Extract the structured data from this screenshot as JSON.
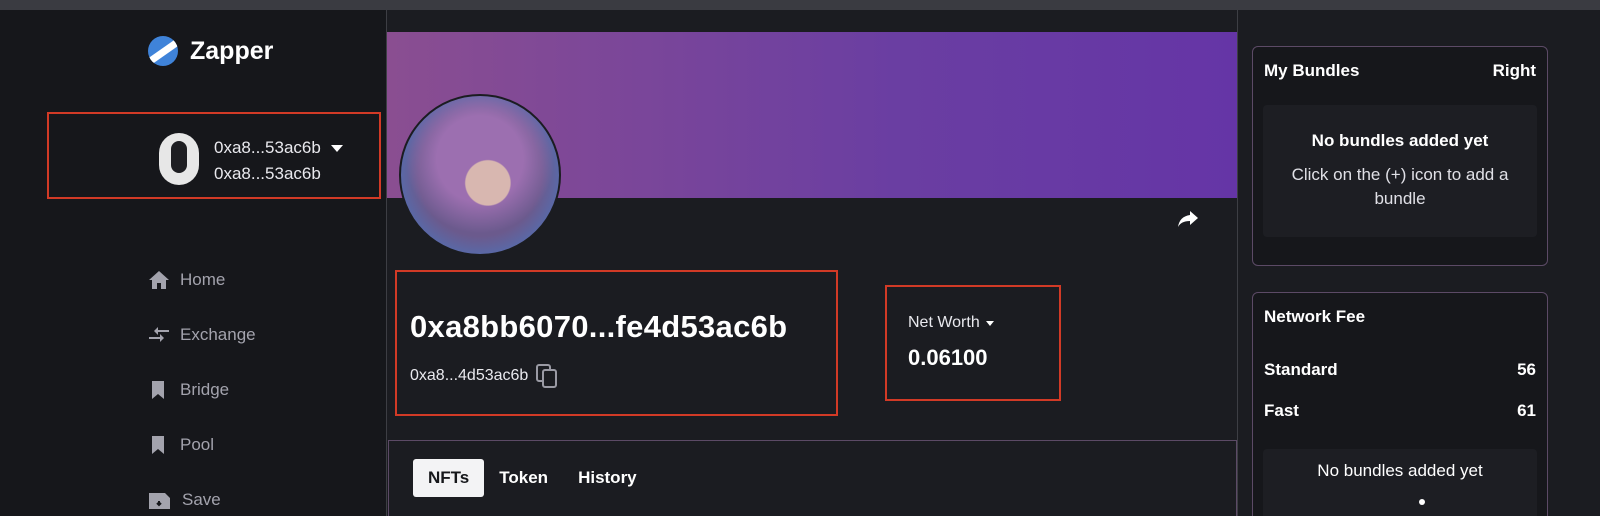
{
  "app": {
    "name": "Zapper"
  },
  "wallet": {
    "label": "0xa8...53ac6b",
    "sublabel": "0xa8...53ac6b"
  },
  "nav": {
    "items": [
      {
        "label": "Home",
        "icon": "home-icon"
      },
      {
        "label": "Exchange",
        "icon": "exchange-icon"
      },
      {
        "label": "Bridge",
        "icon": "bookmark-icon"
      },
      {
        "label": "Pool",
        "icon": "bookmark-icon"
      },
      {
        "label": "Save",
        "icon": "save-icon"
      }
    ]
  },
  "profile": {
    "address_full": "0xa8bb6070...fe4d53ac6b",
    "address_short": "0xa8...4d53ac6b",
    "net_worth_label": "Net Worth",
    "net_worth_value": "0.06100"
  },
  "tabs": [
    {
      "label": "NFTs",
      "active": true
    },
    {
      "label": "Token",
      "active": false
    },
    {
      "label": "History",
      "active": false
    }
  ],
  "bundles": {
    "title": "My Bundles",
    "action": "Right",
    "empty_title": "No bundles added yet",
    "empty_hint": "Click on the (+) icon to add a bundle"
  },
  "network_fee": {
    "title": "Network Fee",
    "rows": [
      {
        "label": "Standard",
        "value": "56"
      },
      {
        "label": "Fast",
        "value": "61"
      }
    ],
    "empty_title": "No bundles added yet"
  },
  "colors": {
    "highlight_border": "#d23a26",
    "banner_start": "#8a4e91",
    "banner_end": "#6535a6",
    "background": "#16171b"
  }
}
